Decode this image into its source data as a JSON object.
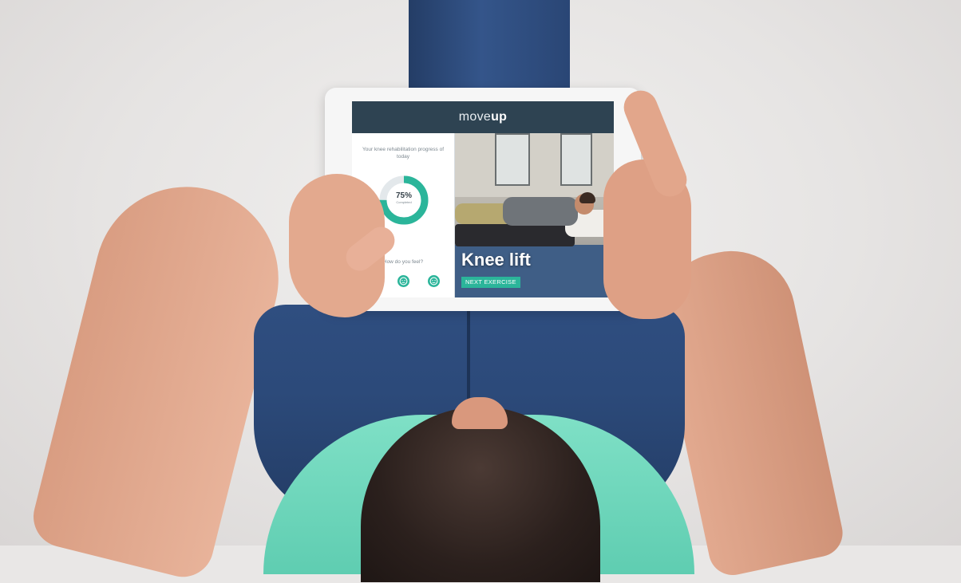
{
  "app": {
    "brand_light": "move",
    "brand_bold": "up"
  },
  "progress": {
    "title": "Your knee rehabilitation progress of today",
    "percent_label": "75%",
    "percent_value": 75,
    "sub_label": "Completed",
    "ring_color": "#2bb59a",
    "track_color": "#e3e8eb"
  },
  "feedback": {
    "question": "How do you feel?",
    "moods": [
      "sad-face-icon",
      "neutral-face-icon",
      "happy-face-icon"
    ]
  },
  "exercise": {
    "title": "Knee lift",
    "next_label": "NEXT EXERCISE"
  },
  "colors": {
    "header": "#2e4352",
    "accent": "#2bb59a"
  }
}
